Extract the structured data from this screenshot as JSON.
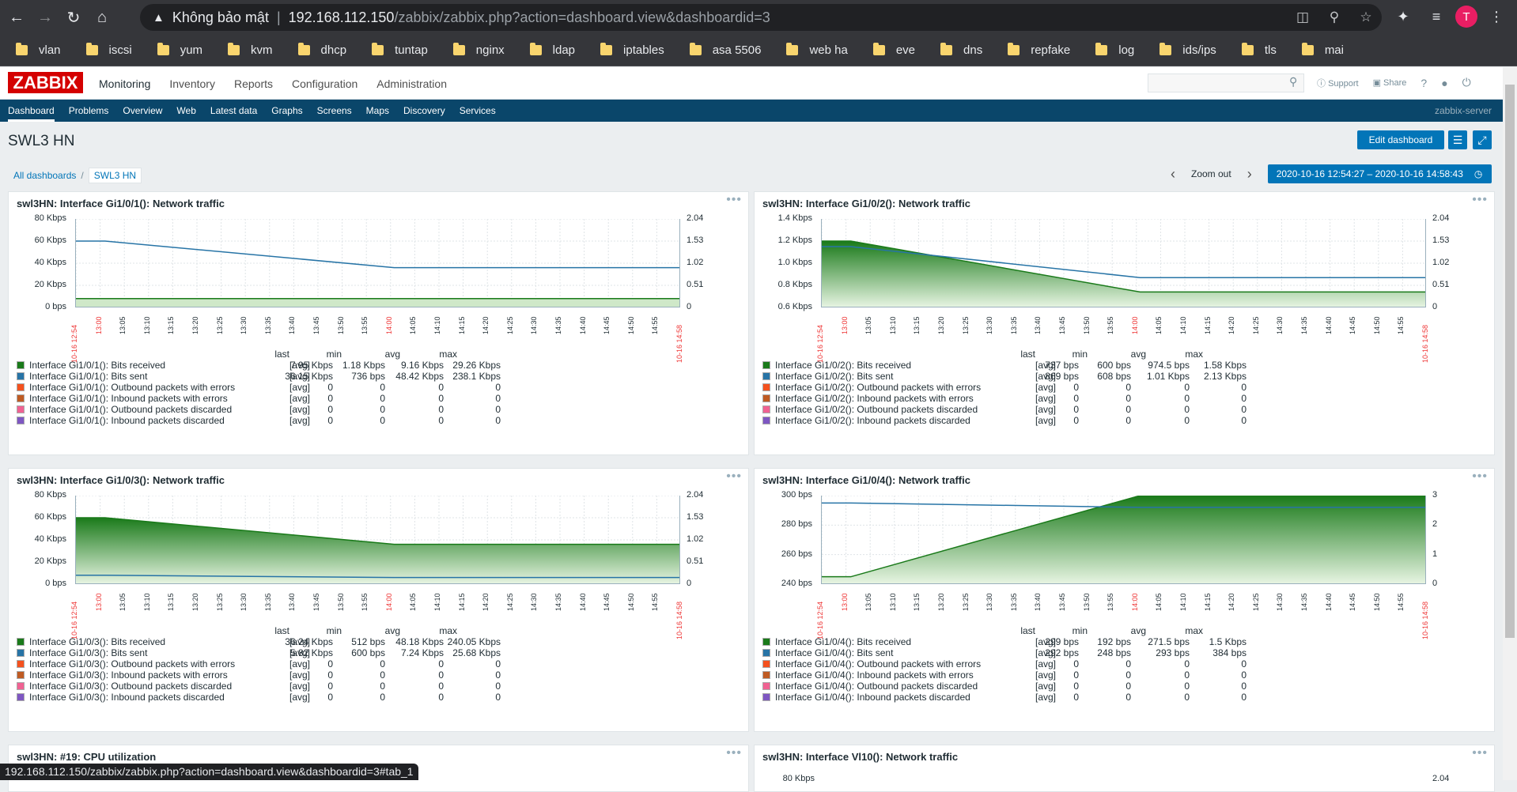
{
  "browser": {
    "security": "Không bảo mật",
    "url_host": "192.168.112.150",
    "url_path": "/zabbix/zabbix.php?action=dashboard.view&dashboardid=3",
    "avatar": "T",
    "bookmarks": [
      "vlan",
      "iscsi",
      "yum",
      "kvm",
      "dhcp",
      "tuntap",
      "nginx",
      "ldap",
      "iptables",
      "asa 5506",
      "web ha",
      "eve",
      "dns",
      "repfake",
      "log",
      "ids/ips",
      "tls",
      "mai"
    ],
    "status_url": "192.168.112.150/zabbix/zabbix.php?action=dashboard.view&dashboardid=3#tab_1"
  },
  "zabbix": {
    "logo": "ZABBIX",
    "menu": [
      "Monitoring",
      "Inventory",
      "Reports",
      "Configuration",
      "Administration"
    ],
    "support": "Support",
    "share": "Share",
    "help": "?",
    "submenu": [
      "Dashboard",
      "Problems",
      "Overview",
      "Web",
      "Latest data",
      "Graphs",
      "Screens",
      "Maps",
      "Discovery",
      "Services"
    ],
    "server": "zabbix-server"
  },
  "page": {
    "title": "SWL3 HN",
    "edit_button": "Edit dashboard",
    "breadcrumb": [
      "All dashboards",
      "SWL3 HN"
    ],
    "zoom_out": "Zoom out",
    "time_range": "2020-10-16 12:54:27 – 2020-10-16 14:58:43"
  },
  "legend_headers": [
    "last",
    "min",
    "avg",
    "max"
  ],
  "colors": {
    "received": "#1a7a1a",
    "sent": "#2774a6",
    "out_err": "#f4511e",
    "in_err": "#bf5b23",
    "out_disc": "#f06292",
    "in_disc": "#7e57c2"
  },
  "x_ticks": [
    "10-16 12:54",
    "13:00",
    "13:05",
    "13:10",
    "13:15",
    "13:20",
    "13:25",
    "13:30",
    "13:35",
    "13:40",
    "13:45",
    "13:50",
    "13:55",
    "14:00",
    "14:05",
    "14:10",
    "14:15",
    "14:20",
    "14:25",
    "14:30",
    "14:35",
    "14:40",
    "14:45",
    "14:50",
    "14:55",
    "10-16 14:58"
  ],
  "widgets": [
    {
      "title": "swl3HN: Interface Gi1/0/1(): Network traffic",
      "yleft": [
        "80 Kbps",
        "60 Kbps",
        "40 Kbps",
        "20 Kbps",
        "0 bps"
      ],
      "yright": [
        "2.04",
        "1.53",
        "1.02",
        "0.51",
        "0"
      ],
      "rows": [
        {
          "name": "Interface Gi1/0/1(): Bits received",
          "fn": "[avg]",
          "last": "7.95 Kbps",
          "min": "1.18 Kbps",
          "avg": "9.16 Kbps",
          "max": "29.26 Kbps"
        },
        {
          "name": "Interface Gi1/0/1(): Bits sent",
          "fn": "[avg]",
          "last": "36.15 Kbps",
          "min": "736 bps",
          "avg": "48.42 Kbps",
          "max": "238.1 Kbps"
        },
        {
          "name": "Interface Gi1/0/1(): Outbound packets with errors",
          "fn": "[avg]",
          "last": "0",
          "min": "0",
          "avg": "0",
          "max": "0"
        },
        {
          "name": "Interface Gi1/0/1(): Inbound packets with errors",
          "fn": "[avg]",
          "last": "0",
          "min": "0",
          "avg": "0",
          "max": "0"
        },
        {
          "name": "Interface Gi1/0/1(): Outbound packets discarded",
          "fn": "[avg]",
          "last": "0",
          "min": "0",
          "avg": "0",
          "max": "0"
        },
        {
          "name": "Interface Gi1/0/1(): Inbound packets discarded",
          "fn": "[avg]",
          "last": "0",
          "min": "0",
          "avg": "0",
          "max": "0"
        }
      ]
    },
    {
      "title": "swl3HN: Interface Gi1/0/2(): Network traffic",
      "yleft": [
        "1.4 Kbps",
        "1.2 Kbps",
        "1.0 Kbps",
        "0.8 Kbps",
        "0.6 Kbps"
      ],
      "yright": [
        "2.04",
        "1.53",
        "1.02",
        "0.51",
        "0"
      ],
      "rows": [
        {
          "name": "Interface Gi1/0/2(): Bits received",
          "fn": "[avg]",
          "last": "737 bps",
          "min": "600 bps",
          "avg": "974.5 bps",
          "max": "1.58 Kbps"
        },
        {
          "name": "Interface Gi1/0/2(): Bits sent",
          "fn": "[avg]",
          "last": "869 bps",
          "min": "608 bps",
          "avg": "1.01 Kbps",
          "max": "2.13 Kbps"
        },
        {
          "name": "Interface Gi1/0/2(): Outbound packets with errors",
          "fn": "[avg]",
          "last": "0",
          "min": "0",
          "avg": "0",
          "max": "0"
        },
        {
          "name": "Interface Gi1/0/2(): Inbound packets with errors",
          "fn": "[avg]",
          "last": "0",
          "min": "0",
          "avg": "0",
          "max": "0"
        },
        {
          "name": "Interface Gi1/0/2(): Outbound packets discarded",
          "fn": "[avg]",
          "last": "0",
          "min": "0",
          "avg": "0",
          "max": "0"
        },
        {
          "name": "Interface Gi1/0/2(): Inbound packets discarded",
          "fn": "[avg]",
          "last": "0",
          "min": "0",
          "avg": "0",
          "max": "0"
        }
      ]
    },
    {
      "title": "swl3HN: Interface Gi1/0/3(): Network traffic",
      "yleft": [
        "80 Kbps",
        "60 Kbps",
        "40 Kbps",
        "20 Kbps",
        "0 bps"
      ],
      "yright": [
        "2.04",
        "1.53",
        "1.02",
        "0.51",
        "0"
      ],
      "rows": [
        {
          "name": "Interface Gi1/0/3(): Bits received",
          "fn": "[avg]",
          "last": "36.24 Kbps",
          "min": "512 bps",
          "avg": "48.18 Kbps",
          "max": "240.05 Kbps"
        },
        {
          "name": "Interface Gi1/0/3(): Bits sent",
          "fn": "[avg]",
          "last": "5.82 Kbps",
          "min": "600 bps",
          "avg": "7.24 Kbps",
          "max": "25.68 Kbps"
        },
        {
          "name": "Interface Gi1/0/3(): Outbound packets with errors",
          "fn": "[avg]",
          "last": "0",
          "min": "0",
          "avg": "0",
          "max": "0"
        },
        {
          "name": "Interface Gi1/0/3(): Inbound packets with errors",
          "fn": "[avg]",
          "last": "0",
          "min": "0",
          "avg": "0",
          "max": "0"
        },
        {
          "name": "Interface Gi1/0/3(): Outbound packets discarded",
          "fn": "[avg]",
          "last": "0",
          "min": "0",
          "avg": "0",
          "max": "0"
        },
        {
          "name": "Interface Gi1/0/3(): Inbound packets discarded",
          "fn": "[avg]",
          "last": "0",
          "min": "0",
          "avg": "0",
          "max": "0"
        }
      ]
    },
    {
      "title": "swl3HN: Interface Gi1/0/4(): Network traffic",
      "yleft": [
        "300 bps",
        "280 bps",
        "260 bps",
        "240 bps"
      ],
      "yright": [
        "3",
        "2",
        "1",
        "0"
      ],
      "rows": [
        {
          "name": "Interface Gi1/0/4(): Bits received",
          "fn": "[avg]",
          "last": "299 bps",
          "min": "192 bps",
          "avg": "271.5 bps",
          "max": "1.5 Kbps"
        },
        {
          "name": "Interface Gi1/0/4(): Bits sent",
          "fn": "[avg]",
          "last": "292 bps",
          "min": "248 bps",
          "avg": "293 bps",
          "max": "384 bps"
        },
        {
          "name": "Interface Gi1/0/4(): Outbound packets with errors",
          "fn": "[avg]",
          "last": "0",
          "min": "0",
          "avg": "0",
          "max": "0"
        },
        {
          "name": "Interface Gi1/0/4(): Inbound packets with errors",
          "fn": "[avg]",
          "last": "0",
          "min": "0",
          "avg": "0",
          "max": "0"
        },
        {
          "name": "Interface Gi1/0/4(): Outbound packets discarded",
          "fn": "[avg]",
          "last": "0",
          "min": "0",
          "avg": "0",
          "max": "0"
        },
        {
          "name": "Interface Gi1/0/4(): Inbound packets discarded",
          "fn": "[avg]",
          "last": "0",
          "min": "0",
          "avg": "0",
          "max": "0"
        }
      ]
    },
    {
      "title": "swl3HN: #19: CPU utilization",
      "yleft": [],
      "yright": [],
      "rows": []
    },
    {
      "title": "swl3HN: Interface Vl10(): Network traffic",
      "yleft": [
        "80 Kbps"
      ],
      "yright": [
        "2.04"
      ],
      "rows": []
    }
  ],
  "chart_data": [
    {
      "type": "line",
      "title": "swl3HN: Interface Gi1/0/1(): Network traffic",
      "x": [
        "12:54",
        "13:00",
        "14:00",
        "14:58"
      ],
      "series": [
        {
          "name": "Interface Gi1/0/1(): Bits received",
          "values": [
            8,
            8,
            8,
            8
          ]
        },
        {
          "name": "Interface Gi1/0/1(): Bits sent",
          "values": [
            60,
            60,
            36,
            36
          ]
        }
      ],
      "ylim": [
        0,
        80
      ]
    },
    {
      "type": "area",
      "title": "swl3HN: Interface Gi1/0/2(): Network traffic",
      "x": [
        "12:54",
        "13:00",
        "14:00",
        "14:58"
      ],
      "series": [
        {
          "name": "Interface Gi1/0/2(): Bits received",
          "values": [
            1.2,
            1.2,
            0.74,
            0.74
          ]
        },
        {
          "name": "Interface Gi1/0/2(): Bits sent",
          "values": [
            1.15,
            1.15,
            0.87,
            0.87
          ]
        }
      ],
      "ylim": [
        0.6,
        1.4
      ]
    },
    {
      "type": "area",
      "title": "swl3HN: Interface Gi1/0/3(): Network traffic",
      "x": [
        "12:54",
        "13:00",
        "14:00",
        "14:58"
      ],
      "series": [
        {
          "name": "Interface Gi1/0/3(): Bits received",
          "values": [
            60,
            60,
            36,
            36
          ]
        },
        {
          "name": "Interface Gi1/0/3(): Bits sent",
          "values": [
            8,
            8,
            6,
            6
          ]
        }
      ],
      "ylim": [
        0,
        80
      ]
    },
    {
      "type": "area",
      "title": "swl3HN: Interface Gi1/0/4(): Network traffic",
      "x": [
        "12:54",
        "13:00",
        "14:00",
        "14:58"
      ],
      "series": [
        {
          "name": "Interface Gi1/0/4(): Bits received",
          "values": [
            245,
            245,
            300,
            300
          ]
        },
        {
          "name": "Interface Gi1/0/4(): Bits sent",
          "values": [
            295,
            295,
            292,
            292
          ]
        }
      ],
      "ylim": [
        240,
        300
      ]
    }
  ]
}
